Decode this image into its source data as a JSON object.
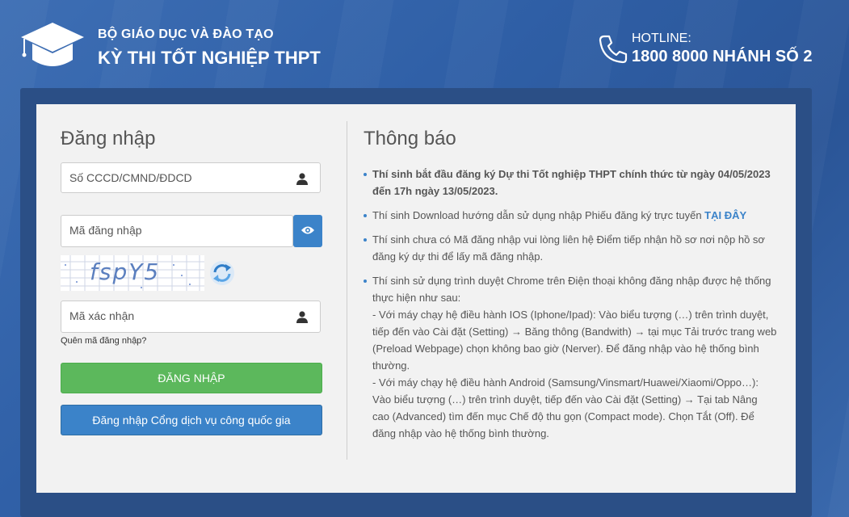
{
  "header": {
    "org_name": "BỘ GIÁO DỤC VÀ ĐÀO TẠO",
    "exam_name": "KỲ THI TỐT NGHIỆP THPT",
    "hotline_label": "HOTLINE:",
    "hotline_number": "1800 8000 NHÁNH SỐ 2",
    "logo_icon": "graduation-cap-icon",
    "phone_icon": "phone-icon"
  },
  "login": {
    "title": "Đăng nhập",
    "id_placeholder": "Số CCCD/CMND/ĐDCD",
    "password_placeholder": "Mã đăng nhập",
    "captcha_text": "fspY5",
    "captcha_placeholder": "Mã xác nhận",
    "forgot_link": "Quên mã đăng nhập?",
    "login_button": "ĐĂNG NHẬP",
    "national_portal_button": "Đăng nhập Cổng dịch vụ công quốc gia"
  },
  "notice": {
    "title": "Thông báo",
    "items": [
      {
        "text": "Thí sinh bắt đầu đăng ký Dự thi Tốt nghiệp THPT chính thức từ ngày 04/05/2023 đến 17h ngày 13/05/2023."
      },
      {
        "text": "Thí sinh Download hướng dẫn sử dụng nhập Phiếu đăng ký trực tuyến ",
        "link": "TẠI ĐÂY"
      },
      {
        "text": "Thí sinh chưa có Mã đăng nhập vui lòng liên hệ Điểm tiếp nhận hồ sơ nơi nộp hồ sơ đăng ký dự thi để lấy mã đăng nhập."
      },
      {
        "text": "Thí sinh sử dụng trình duyệt Chrome trên Điện thoại không đăng nhập được hệ thống thực hiện như sau:",
        "sub1": " - Với máy chạy hệ điều hành IOS (Iphone/Ipad): Vào biểu tượng (…) trên trình duyệt, tiếp đến vào Cài đặt (Setting) → Băng thông (Bandwith) → tại mục Tải trước trang web (Preload Webpage) chọn không bao giờ (Nerver). Để đăng nhập vào hệ thống bình thường.",
        "sub2": " - Với máy chạy hệ điều hành Android (Samsung/Vinsmart/Huawei/Xiaomi/Oppo…): Vào biểu tượng (…) trên trình duyệt, tiếp đến vào Cài đặt (Setting) → Tại tab Nâng cao (Advanced) tìm đến mục Chế độ thu gọn (Compact mode). Chọn Tắt (Off). Để đăng nhập vào hệ thống bình thường."
      }
    ]
  },
  "colors": {
    "accent": "#3b83c9",
    "success": "#5cb85c",
    "background": "#2f5fa6",
    "panel": "#f2f2f2"
  }
}
